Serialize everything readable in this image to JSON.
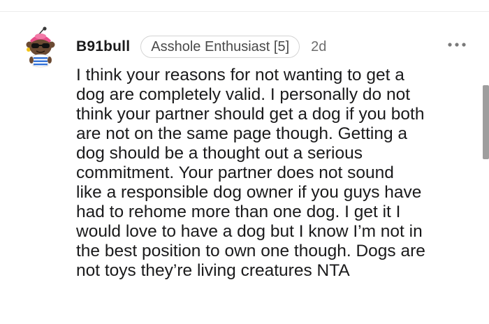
{
  "comment": {
    "author": "B91bull",
    "flair": "Asshole Enthusiast [5]",
    "age": "2d",
    "more_icon": "more-horizontal-icon",
    "avatar_icon": "snoo-avatar-icon",
    "body": "I think your reasons for not wanting to get a\ndog are completely valid. I personally do not\nthink your partner should get a dog if you both\nare not on the same page though. Getting a\ndog should be a thought out a serious\ncommitment. Your partner does not sound\nlike a responsible dog owner if you guys have\nhad to rehome more than one dog. I get it I\nwould love to have a dog but I know I’m not in\nthe best position to own one though. Dogs are\nnot toys they’re living creatures NTA"
  },
  "colors": {
    "text": "#1a1a1b",
    "meta": "#6e6e6e",
    "flair_border": "#d4d4d4",
    "scrollbar": "#9e9e9e"
  }
}
